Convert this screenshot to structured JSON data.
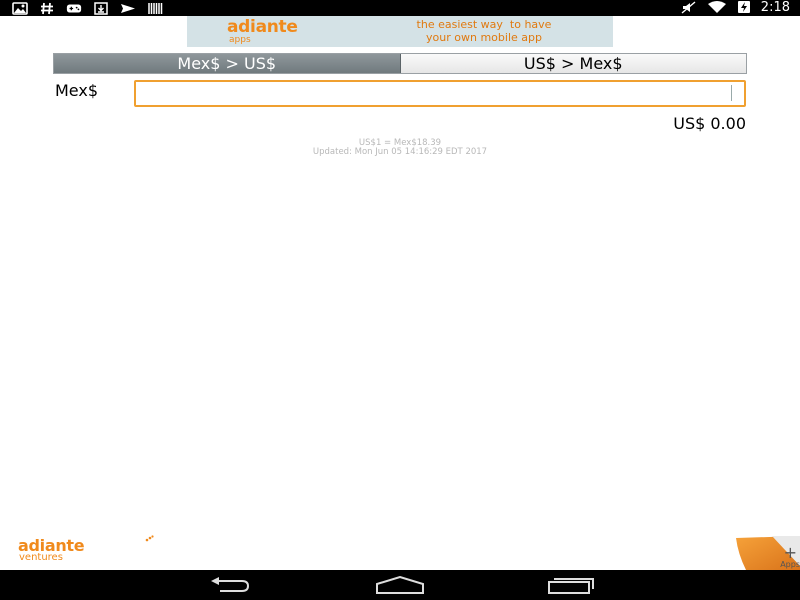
{
  "status_bar": {
    "left_icons": [
      "gallery-notification-icon",
      "hash-notification-icon",
      "gamepad-notification-icon",
      "download-notification-icon",
      "send-notification-icon",
      "barcode-notification-icon"
    ],
    "right_icons": [
      "mute-icon",
      "wifi-icon",
      "battery-charging-icon"
    ],
    "time": "2:18"
  },
  "ad_banner": {
    "brand": "adiante",
    "brand_sub": "apps",
    "tagline_line1": "the easiest way  to have",
    "tagline_line2": "your own mobile app"
  },
  "toggle": {
    "options": [
      "Mex$ > US$",
      "US$ > Mex$"
    ],
    "selected": "Mex$ > US$"
  },
  "input": {
    "label": "Mex$",
    "value": "",
    "placeholder": ""
  },
  "result": {
    "text": "US$ 0.00"
  },
  "rate_info": {
    "rate": "US$1 = Mex$18.39",
    "updated": "Updated: Mon Jun 05 14:16:29 EDT 2017"
  },
  "footer": {
    "brand": "adiante",
    "brand_sub": "ventures",
    "apps_plus": "+",
    "apps_label": "Apps"
  },
  "nav_bar": {
    "buttons": [
      "back-icon",
      "home-icon",
      "recents-icon"
    ]
  },
  "colors": {
    "accent_orange": "#f08a1c",
    "input_border": "#f0a030",
    "ad_background": "#d4e2e6",
    "toggle_active": "#7b8488"
  }
}
